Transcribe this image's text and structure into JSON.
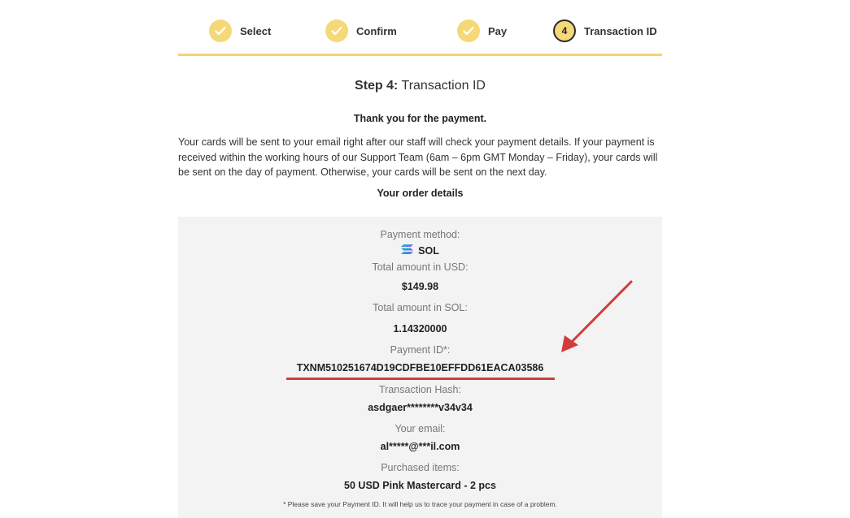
{
  "steps": [
    {
      "label": "Select",
      "state": "done"
    },
    {
      "label": "Confirm",
      "state": "done"
    },
    {
      "label": "Pay",
      "state": "done"
    },
    {
      "label": "Transaction ID",
      "state": "current",
      "number": "4"
    }
  ],
  "heading": {
    "step": "Step 4:",
    "name": "Transaction ID"
  },
  "thanks": "Thank you for the payment.",
  "info": "Your cards will be sent to your email right after our staff will check your payment details. If your payment is received within the working hours of our Support Team (6am – 6pm GMT Monday – Friday), your cards will be sent on the day of payment. Otherwise, your cards will be sent on the next day.",
  "order_heading": "Your order details",
  "details": {
    "payment_method_label": "Payment method:",
    "payment_method_value": "SOL",
    "usd_label": "Total amount in USD:",
    "usd_value": "$149.98",
    "sol_label": "Total amount in SOL:",
    "sol_value": "1.14320000",
    "payment_id_label": "Payment ID*:",
    "payment_id_value": "TXNM510251674D19CDFBE10EFFDD61EACA03586",
    "hash_label": "Transaction Hash:",
    "hash_value": "asdgaer********v34v34",
    "email_label": "Your email:",
    "email_value": "al*****@***il.com",
    "items_label": "Purchased items:",
    "items_value": "50 USD Pink Mastercard - 2 pcs",
    "note": "* Please save your Payment ID. It will help us to trace your payment in case of a problem."
  },
  "colors": {
    "accent": "#f5d877",
    "annotation": "#d33c3a",
    "panel": "#f3f3f3"
  }
}
